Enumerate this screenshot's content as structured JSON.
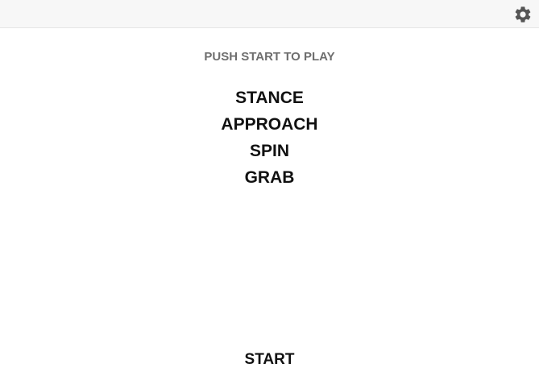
{
  "header": {
    "settings_icon": "gear-icon"
  },
  "main": {
    "prompt": "PUSH START TO PLAY",
    "tricks": [
      {
        "label": "STANCE"
      },
      {
        "label": "APPROACH"
      },
      {
        "label": "SPIN"
      },
      {
        "label": "GRAB"
      }
    ]
  },
  "footer": {
    "start_label": "START"
  },
  "colors": {
    "topbar_bg": "#f7f7f7",
    "prompt_text": "#6e6e6e",
    "primary_text": "#111111",
    "icon": "#555555"
  }
}
